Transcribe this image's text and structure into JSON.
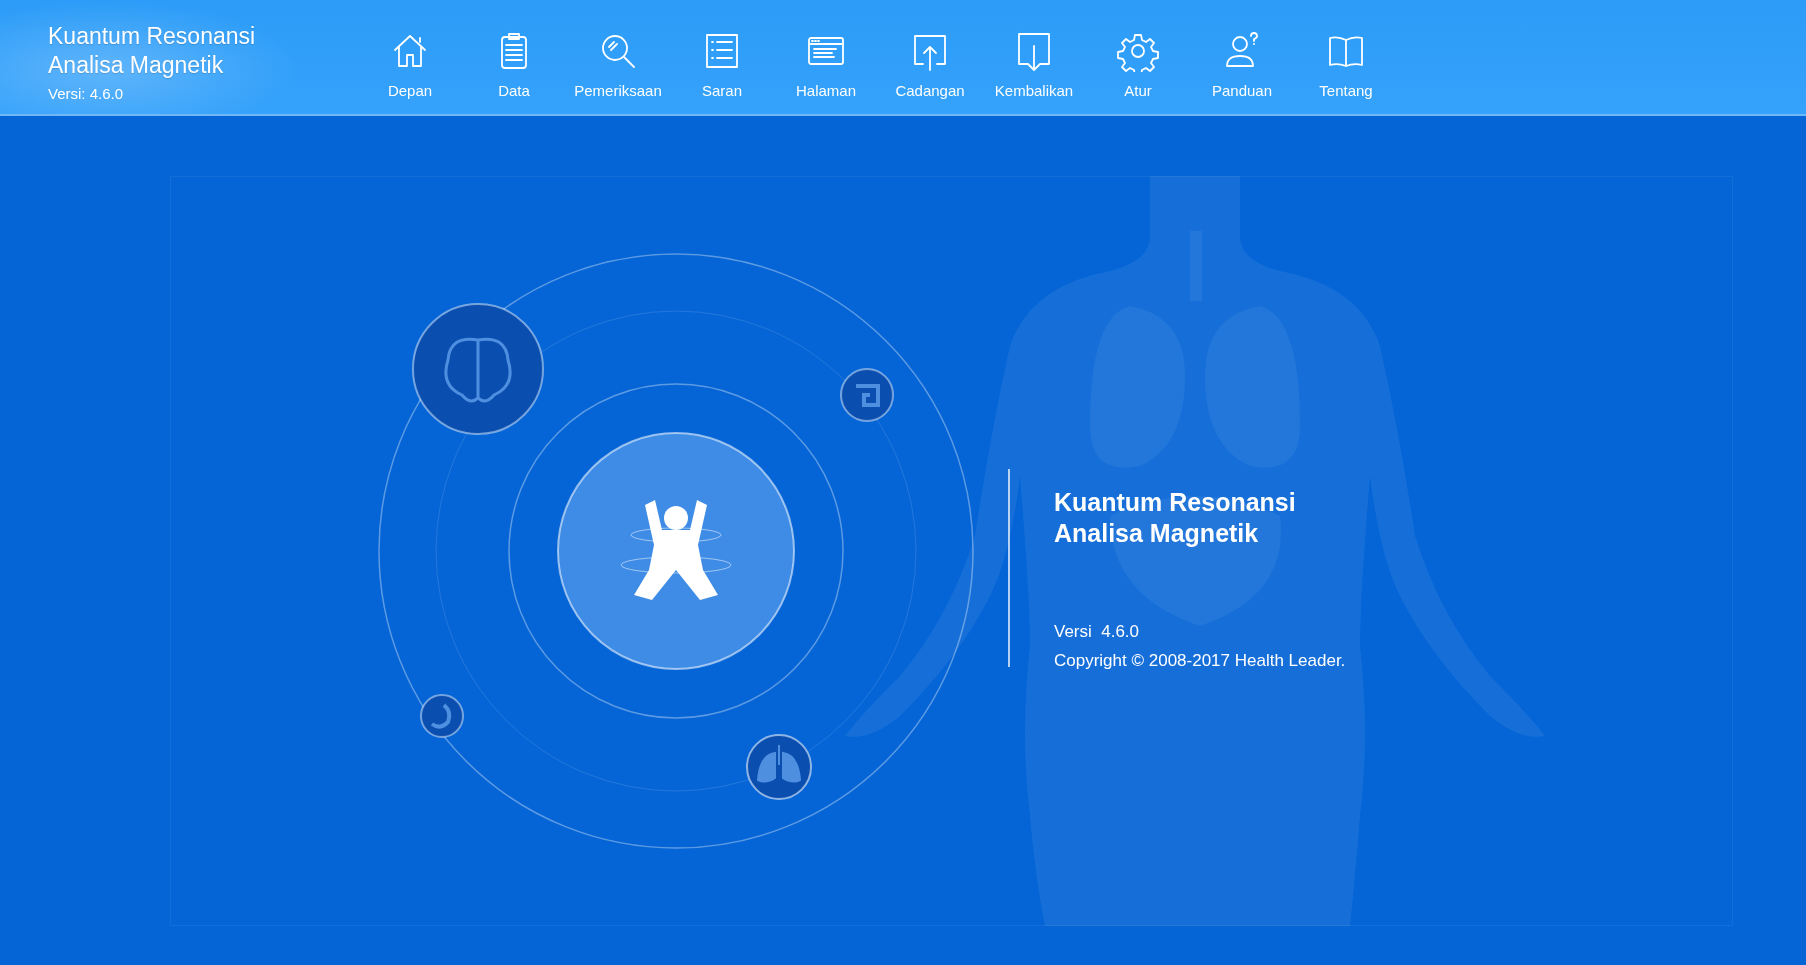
{
  "app": {
    "title_lines": [
      "Kuantum Resonansi",
      "Analisa Magnetik"
    ],
    "version": "Versi: 4.6.0"
  },
  "nav": [
    {
      "label": "Depan"
    },
    {
      "label": "Data"
    },
    {
      "label": "Pemeriksaan"
    },
    {
      "label": "Saran"
    },
    {
      "label": "Halaman"
    },
    {
      "label": "Cadangan"
    },
    {
      "label": "Kembalikan"
    },
    {
      "label": "Atur"
    },
    {
      "label": "Panduan"
    },
    {
      "label": "Tentang"
    }
  ],
  "about": {
    "title_lines": [
      "Kuantum Resonansi",
      "Analisa Magnetik"
    ],
    "version": "Versi  4.6.0",
    "copyright": "Copyright © 2008-2017 Health Leader."
  }
}
